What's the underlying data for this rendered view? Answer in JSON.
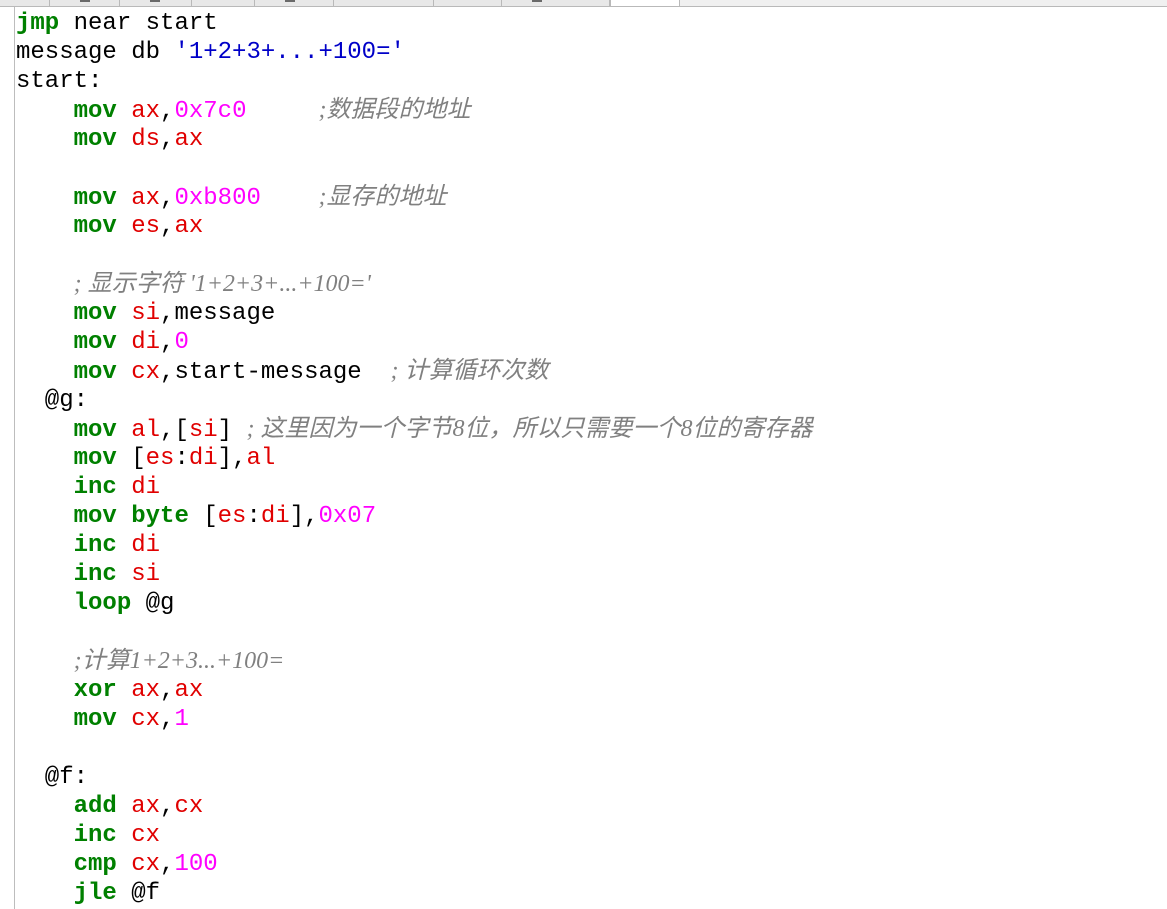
{
  "tabs": [
    {
      "label": "",
      "width": 0
    },
    {
      "label": "",
      "width": 0
    }
  ],
  "code": {
    "lines": [
      "jmp near start",
      "message db '1+2+3+...+100='",
      "start:",
      "    mov ax,0x7c0     ;数据段的地址",
      "    mov ds,ax",
      "",
      "    mov ax,0xb800    ;显存的地址",
      "    mov es,ax",
      "",
      "    ; 显示字符 '1+2+3+...+100='",
      "    mov si,message",
      "    mov di,0",
      "    mov cx,start-message  ; 计算循环次数",
      "  @g:",
      "    mov al,[si] ; 这里因为一个字节8位，所以只需要一个8位的寄存器",
      "    mov [es:di],al",
      "    inc di",
      "    mov byte [es:di],0x07",
      "    inc di",
      "    inc si",
      "    loop @g",
      "",
      "    ;计算1+2+3...+100=",
      "    xor ax,ax",
      "    mov cx,1",
      "",
      "  @f:",
      "    add ax,cx",
      "    inc cx",
      "    cmp cx,100",
      "    jle @f"
    ]
  },
  "colors": {
    "keyword": "#008000",
    "register": "#e00000",
    "number": "#ff00ff",
    "string": "#0000c8",
    "comment": "#808080"
  }
}
